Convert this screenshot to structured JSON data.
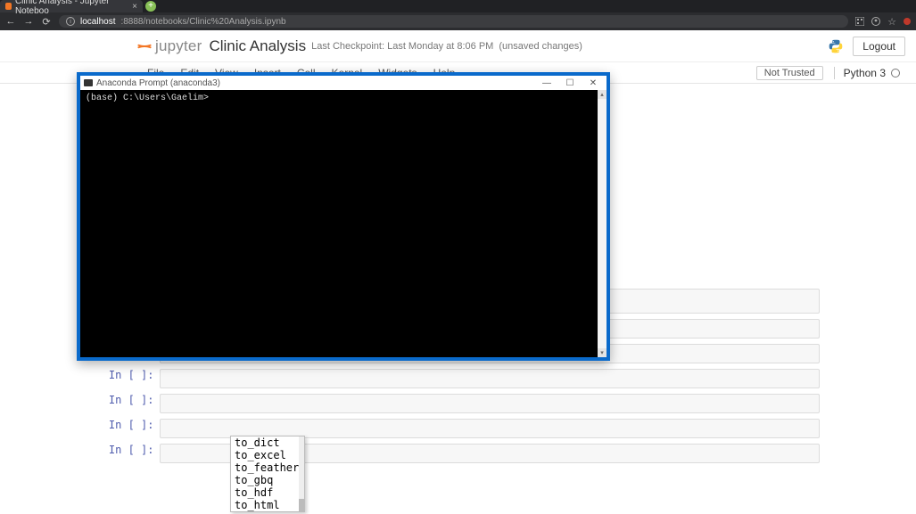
{
  "browser": {
    "tab_title": "Clinic Analysis - Jupyter Noteboo",
    "url_host": "localhost",
    "url_port_path": ":8888/notebooks/Clinic%20Analysis.ipynb"
  },
  "jupyter": {
    "logo_text": "jupyter",
    "notebook_name": "Clinic Analysis",
    "checkpoint": "Last Checkpoint: Last Monday at 8:06 PM",
    "unsaved": "(unsaved changes)",
    "logout": "Logout",
    "not_trusted": "Not Trusted",
    "kernel": "Python 3",
    "menu": [
      "File",
      "Edit",
      "View",
      "Insert",
      "Cell",
      "Kernel",
      "Widgets",
      "Help"
    ]
  },
  "cells": {
    "prompt": "In [ ]:"
  },
  "autocomplete": {
    "items": [
      "to_dict",
      "to_excel",
      "to_feather",
      "to_gbq",
      "to_hdf",
      "to_html"
    ]
  },
  "terminal": {
    "title": "Anaconda Prompt (anaconda3)",
    "prompt_line": "(base) C:\\Users\\Gaelim>"
  }
}
